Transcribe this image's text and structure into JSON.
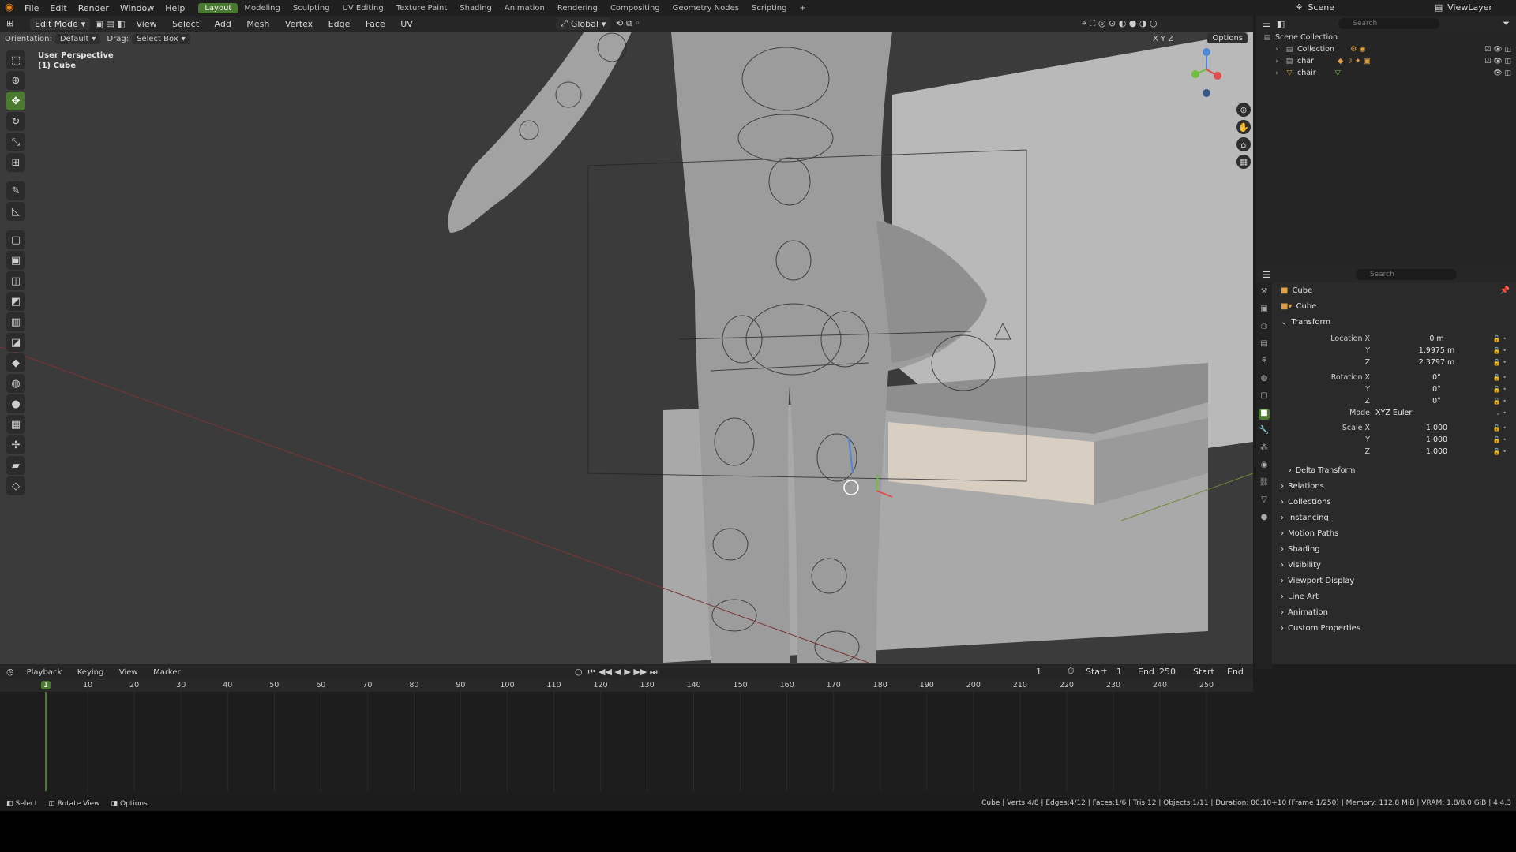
{
  "topbar": {
    "menus": [
      "File",
      "Edit",
      "Render",
      "Window",
      "Help"
    ],
    "workspaces": [
      "Layout",
      "Modeling",
      "Sculpting",
      "UV Editing",
      "Texture Paint",
      "Shading",
      "Animation",
      "Rendering",
      "Compositing",
      "Geometry Nodes",
      "Scripting"
    ],
    "active_workspace": "Layout",
    "scene": "Scene",
    "view_layer": "ViewLayer"
  },
  "viewport_header": {
    "mode": "Edit Mode",
    "menus": [
      "View",
      "Select",
      "Add",
      "Mesh",
      "Vertex",
      "Edge",
      "Face",
      "UV"
    ],
    "transform_orientation": "Global",
    "orientation_label": "Orientation:",
    "orientation_value": "Default",
    "drag_label": "Drag:",
    "drag_value": "Select Box",
    "options": "Options",
    "axes": [
      "X",
      "Y",
      "Z"
    ]
  },
  "viewport": {
    "perspective": "User Perspective",
    "object": "(1) Cube"
  },
  "toolbar": {
    "tools": [
      "tweak-icon",
      "cursor-icon",
      "move-icon",
      "rotate-icon",
      "scale-icon",
      "transform-icon",
      "annotate-icon",
      "measure-icon",
      "add-cube-icon",
      "extrude-icon",
      "inset-icon",
      "bevel-icon",
      "loop-cut-icon",
      "knife-icon",
      "poly-build-icon",
      "spin-icon",
      "smooth-icon",
      "edge-slide-icon",
      "shrink-icon",
      "shear-icon",
      "rip-icon"
    ],
    "active_index": 2
  },
  "outliner": {
    "search_placeholder": "Search",
    "rows": [
      {
        "label": "Scene Collection",
        "indent": 0
      },
      {
        "label": "Collection",
        "indent": 1
      },
      {
        "label": "char",
        "indent": 1
      },
      {
        "label": "chair",
        "indent": 1
      }
    ]
  },
  "properties": {
    "search_placeholder": "Search",
    "object_name": "Cube",
    "data_name": "Cube",
    "transform_label": "Transform",
    "location": {
      "label": "Location X",
      "x": "0 m",
      "y": "1.9975 m",
      "z": "2.3797 m"
    },
    "rotation": {
      "label": "Rotation X",
      "x": "0°",
      "y": "0°",
      "z": "0°"
    },
    "mode": {
      "label": "Mode",
      "value": "XYZ Euler"
    },
    "scale": {
      "label": "Scale X",
      "x": "1.000",
      "y": "1.000",
      "z": "1.000"
    },
    "axis_y": "Y",
    "axis_z": "Z",
    "sections": [
      "Delta Transform",
      "Relations",
      "Collections",
      "Instancing",
      "Motion Paths",
      "Shading",
      "Visibility",
      "Viewport Display",
      "Line Art",
      "Animation",
      "Custom Properties"
    ]
  },
  "timeline": {
    "menus": [
      "Playback",
      "Keying",
      "View",
      "Marker"
    ],
    "current_frame": "1",
    "start_label": "Start",
    "start": "1",
    "end_label": "End",
    "end": "250",
    "start_short": "Start",
    "end_short": "End",
    "ticks": [
      "1",
      "10",
      "20",
      "30",
      "40",
      "50",
      "60",
      "70",
      "80",
      "90",
      "100",
      "110",
      "120",
      "130",
      "140",
      "150",
      "160",
      "170",
      "180",
      "190",
      "200",
      "210",
      "220",
      "230",
      "240",
      "250"
    ]
  },
  "statusbar": {
    "left": [
      "Select",
      "Rotate View",
      "Options"
    ],
    "right": "Cube | Verts:4/8 | Edges:4/12 | Faces:1/6 | Tris:12 | Objects:1/11 | Duration: 00:10+10 (Frame 1/250) | Memory: 112.8 MiB | VRAM: 1.8/8.0 GiB | 4.4.3"
  },
  "colors": {
    "accent": "#4a7a2f",
    "x_axis": "#e04c4c",
    "y_axis": "#6fbf3f",
    "z_axis": "#4e86d6"
  }
}
